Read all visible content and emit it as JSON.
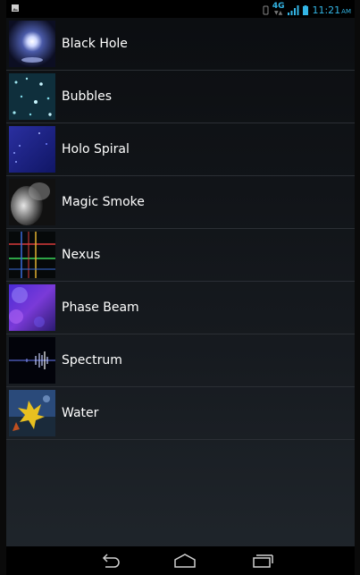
{
  "status_bar": {
    "network_label": "4G",
    "time": "11:21",
    "ampm": "AM",
    "accent": "#33b5e5"
  },
  "wallpapers": [
    {
      "label": "Black Hole",
      "icon": "black-hole-thumbnail"
    },
    {
      "label": "Bubbles",
      "icon": "bubbles-thumbnail"
    },
    {
      "label": "Holo Spiral",
      "icon": "holo-spiral-thumbnail"
    },
    {
      "label": "Magic Smoke",
      "icon": "magic-smoke-thumbnail"
    },
    {
      "label": "Nexus",
      "icon": "nexus-thumbnail"
    },
    {
      "label": "Phase Beam",
      "icon": "phase-beam-thumbnail"
    },
    {
      "label": "Spectrum",
      "icon": "spectrum-thumbnail"
    },
    {
      "label": "Water",
      "icon": "water-thumbnail"
    }
  ],
  "nav_bar": {
    "buttons": [
      "back-icon",
      "home-icon",
      "recent-apps-icon"
    ]
  }
}
